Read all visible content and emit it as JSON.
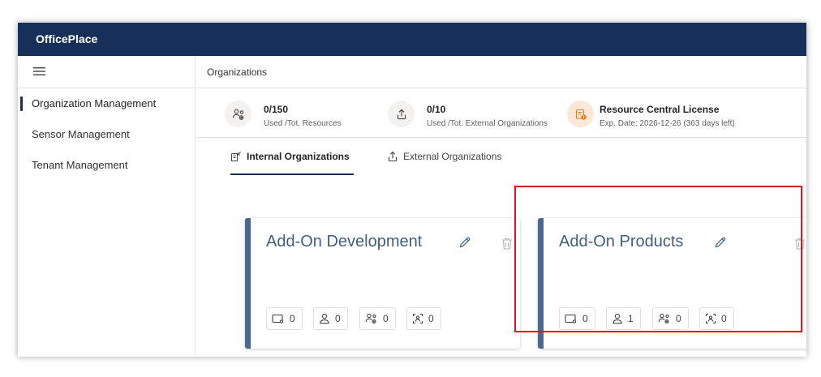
{
  "app": {
    "title": "OfficePlace"
  },
  "sidebar": {
    "items": [
      {
        "label": "Organization Management",
        "active": true
      },
      {
        "label": "Sensor Management",
        "active": false
      },
      {
        "label": "Tenant Management",
        "active": false
      }
    ]
  },
  "header": {
    "breadcrumb": "Organizations"
  },
  "stats": [
    {
      "value": "0/150",
      "label": "Used /Tot. Resources",
      "icon": "resources-icon"
    },
    {
      "value": "0/10",
      "label": "Used /Tot. External Organizations",
      "icon": "upload-icon"
    },
    {
      "value": "Resource Central License",
      "label": "Exp. Date: 2026-12-26 (363 days left)",
      "icon": "license-icon"
    }
  ],
  "tabs": [
    {
      "label": "Internal Organizations",
      "active": true,
      "icon": "internal-org-icon"
    },
    {
      "label": "External Organizations",
      "active": false,
      "icon": "upload-icon"
    }
  ],
  "cards": [
    {
      "title": "Add-On Development",
      "counts": {
        "devices": "0",
        "users": "0",
        "resources": "0",
        "sensors": "0"
      }
    },
    {
      "title": "Add-On Products",
      "counts": {
        "devices": "0",
        "users": "1",
        "resources": "0",
        "sensors": "0"
      }
    }
  ],
  "colors": {
    "topbar": "#17305a",
    "card_accent": "#4a6890",
    "card_title": "#3f5e82",
    "highlight": "#e1131d",
    "license_icon_bg": "#fde7d6"
  }
}
